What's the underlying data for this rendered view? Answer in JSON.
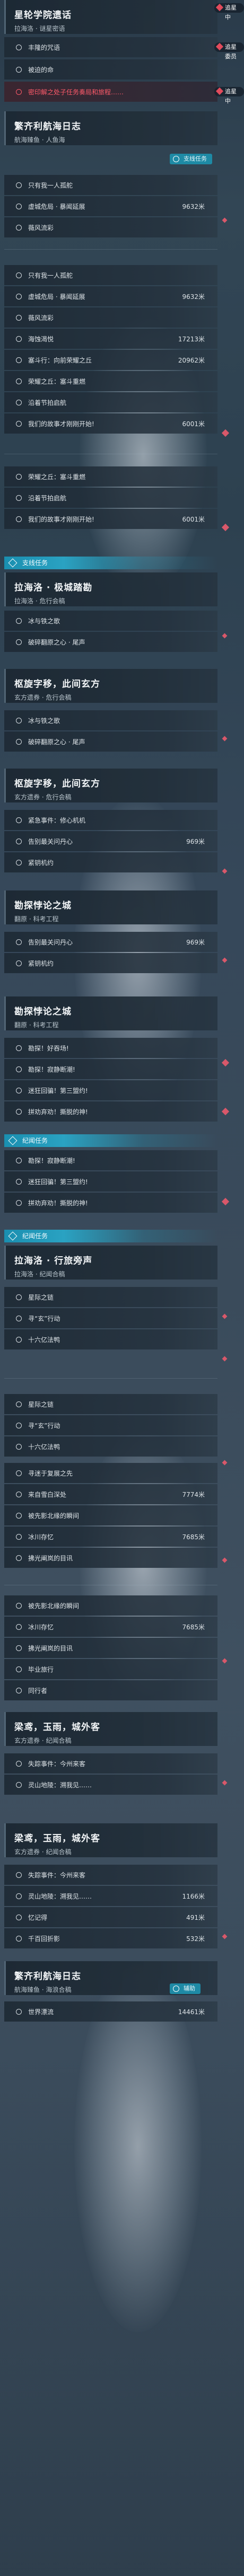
{
  "colors": {
    "accent": "#1e8aa5",
    "alert": "#ff5a6a",
    "marker": "#d9586a"
  },
  "badges": {
    "follow": "追星中",
    "quest_tracking": "追星委员",
    "aux": "辅助"
  },
  "sections": [
    {
      "id": "s1",
      "title": "星轮学院遗话",
      "sub": "拉海洛 · 谜星密语"
    },
    {
      "id": "s2",
      "title": "繁齐利航海日志",
      "sub": "航海臻鱼 · 人鱼海"
    },
    {
      "id": "s3",
      "title": "拉海洛 · 极城踏勘",
      "sub": "拉海洛 · 危行会稿"
    },
    {
      "id": "s4",
      "title": "枢旋字移，此间玄方",
      "sub": "玄方遗券 · 危行会稿"
    },
    {
      "id": "s5",
      "title": "枢旋字移，此间玄方",
      "sub": "玄方遗券 · 危行会稿"
    },
    {
      "id": "s6",
      "title": "勘探悖论之城",
      "sub": "翻原 · 科考工程"
    },
    {
      "id": "s7",
      "title": "勘探悖论之城",
      "sub": "翻原 · 科考工程"
    },
    {
      "id": "s8",
      "title": "拉海洛 · 行旅旁声",
      "sub": "拉海洛 · 纪闻合稿"
    },
    {
      "id": "s9",
      "title": "梁鸢，玉雨，城外客",
      "sub": "玄方遗券 · 纪闻合稿"
    },
    {
      "id": "s10",
      "title": "梁鸢，玉雨，城外客",
      "sub": "玄方遗券 · 纪闻合稿"
    },
    {
      "id": "s11",
      "title": "繁齐利航海日志",
      "sub": "航海臻鱼 · 海浪合稿"
    }
  ],
  "section_headers": {
    "side": "支线任务",
    "wander": "纪闻任务",
    "wander2": "纪闻任务"
  },
  "rows": [
    {
      "t": "丰隆的咒语",
      "d": ""
    },
    {
      "t": "被迫的命",
      "d": ""
    },
    {
      "t": "密印解之处子任务奏局和旅程……",
      "d": ""
    },
    {
      "t": "只有我一人孤舵",
      "d": ""
    },
    {
      "t": "虚城危局 · 暴闻延展",
      "d": "9632米"
    },
    {
      "t": "薇风流彩",
      "d": ""
    },
    {
      "t": "只有我一人孤舵",
      "d": ""
    },
    {
      "t": "虚城危局 · 暴闻延展",
      "d": "9632米"
    },
    {
      "t": "薇风流彩",
      "d": ""
    },
    {
      "t": "海蚀渴悦",
      "d": "17213米"
    },
    {
      "t": "塞斗行：向前荣耀之丘",
      "d": "20962米"
    },
    {
      "t": "荣耀之丘：塞斗重燃",
      "d": ""
    },
    {
      "t": "沿着节拍启航",
      "d": ""
    },
    {
      "t": "我们的故事才刚刚开始!",
      "d": "6001米"
    },
    {
      "t": "荣耀之丘：塞斗重燃",
      "d": ""
    },
    {
      "t": "沿着节拍启航",
      "d": ""
    },
    {
      "t": "我们的故事才刚刚开始!",
      "d": "6001米"
    },
    {
      "t": "冰与铁之歌",
      "d": ""
    },
    {
      "t": "破碎翻原之心 · 尾声",
      "d": ""
    },
    {
      "t": "冰与铁之歌",
      "d": ""
    },
    {
      "t": "破碎翻原之心 · 尾声",
      "d": ""
    },
    {
      "t": "紧急事件：修心机机",
      "d": ""
    },
    {
      "t": "告别最关问丹心",
      "d": "969米"
    },
    {
      "t": "紧钥机约",
      "d": ""
    },
    {
      "t": "告别最关问丹心",
      "d": "969米"
    },
    {
      "t": "紧钥机约",
      "d": ""
    },
    {
      "t": "勘探！好吞场!",
      "d": ""
    },
    {
      "t": "勘探！寂静断潮!",
      "d": ""
    },
    {
      "t": "迷狂回骗！第三盟约!",
      "d": ""
    },
    {
      "t": "拼劝弃劝！撕脱的神!",
      "d": ""
    },
    {
      "t": "勘探！寂静断潮!",
      "d": ""
    },
    {
      "t": "迷狂回骗！第三盟约!",
      "d": ""
    },
    {
      "t": "拼劝弃劝！撕脱的神!",
      "d": ""
    },
    {
      "t": "星际之链",
      "d": ""
    },
    {
      "t": "寻“玄”行动",
      "d": ""
    },
    {
      "t": "十六亿法鸭",
      "d": ""
    },
    {
      "t": "星际之链",
      "d": ""
    },
    {
      "t": "寻“玄”行动",
      "d": ""
    },
    {
      "t": "十六亿法鸭",
      "d": ""
    },
    {
      "t": "寻迷于复展之先",
      "d": ""
    },
    {
      "t": "来自雪白深处",
      "d": "7774米"
    },
    {
      "t": "被先影北缘的瞬间",
      "d": ""
    },
    {
      "t": "冰川存忆",
      "d": "7685米"
    },
    {
      "t": "拂光阐岚的目讯",
      "d": ""
    },
    {
      "t": "被先影北缘的瞬间",
      "d": ""
    },
    {
      "t": "冰川存忆",
      "d": "7685米"
    },
    {
      "t": "拂光阐岚的目讯",
      "d": ""
    },
    {
      "t": "毕业旅行",
      "d": ""
    },
    {
      "t": "同行者",
      "d": ""
    },
    {
      "t": "失踪事件：今州来客",
      "d": ""
    },
    {
      "t": "灵山地陵：溯我见……",
      "d": ""
    },
    {
      "t": "失踪事件：今州来客",
      "d": ""
    },
    {
      "t": "灵山地陵：溯我见……",
      "d": "1166米"
    },
    {
      "t": "忆记得",
      "d": "491米"
    },
    {
      "t": "千百回折影",
      "d": "532米"
    },
    {
      "t": "世界漂流",
      "d": "14461米"
    }
  ]
}
